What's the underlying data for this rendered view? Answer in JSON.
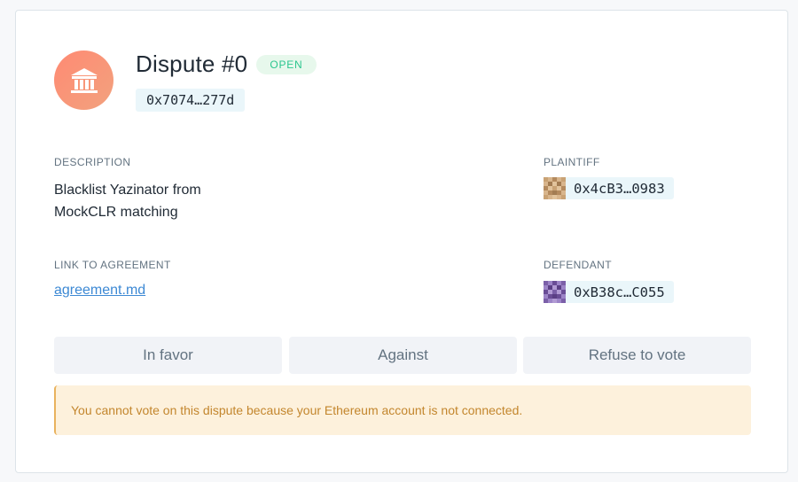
{
  "dispute": {
    "title": "Dispute #0",
    "status": "OPEN",
    "address": "0x7074…277d",
    "icon": "bank-icon"
  },
  "description": {
    "label": "DESCRIPTION",
    "text": "Blacklist Yazinator from MockCLR matching"
  },
  "agreement": {
    "label": "LINK TO AGREEMENT",
    "link_text": "agreement.md"
  },
  "plaintiff": {
    "label": "PLAINTIFF",
    "address": "0x4cB3…0983"
  },
  "defendant": {
    "label": "DEFENDANT",
    "address": "0xB38c…C055"
  },
  "votes": {
    "in_favor": "In favor",
    "against": "Against",
    "refuse": "Refuse to vote"
  },
  "warning": {
    "text": "You cannot vote on this dispute because your Ethereum account is not connected."
  },
  "colors": {
    "status_green": "#2cc68f",
    "link_blue": "#3d89d4",
    "warning_bg": "#fdf1dc",
    "warning_text": "#c3862d",
    "avatar_gradient": "#ff8a73"
  }
}
